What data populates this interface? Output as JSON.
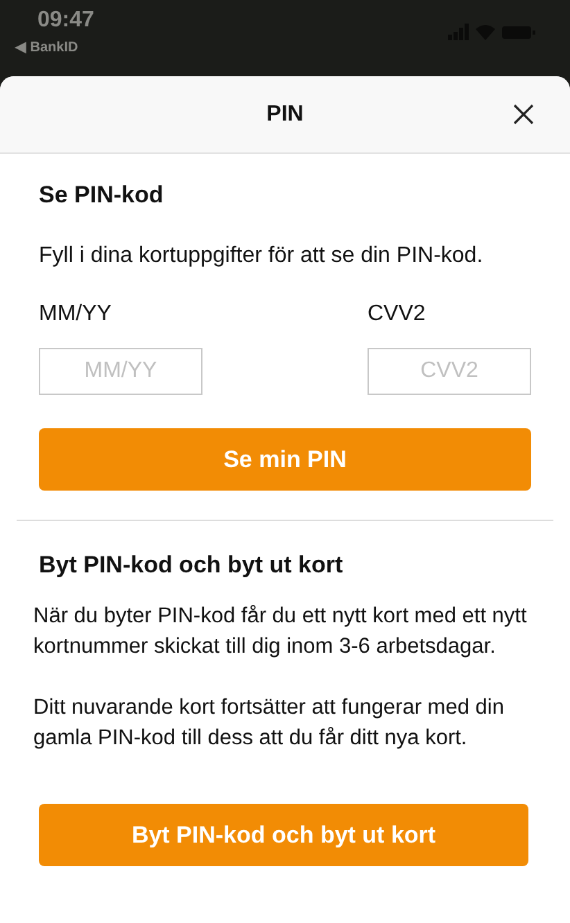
{
  "status_bar": {
    "time": "09:47",
    "back_label": "◀ BankID"
  },
  "sheet": {
    "title": "PIN"
  },
  "view_pin": {
    "heading": "Se PIN-kod",
    "text": "Fyll i dina kortuppgifter för att se din PIN-kod.",
    "fields": [
      {
        "label": "MM/YY",
        "placeholder": "MM/YY"
      },
      {
        "label": "CVV2",
        "placeholder": "CVV2"
      }
    ],
    "button": "Se min PIN"
  },
  "change_pin": {
    "heading": "Byt PIN-kod och byt ut kort",
    "paragraphs": [
      "När du byter PIN-kod får du ett nytt kort med ett nytt kortnummer skickat till dig inom 3-6 arbetsdagar.",
      "Ditt nuvarande kort fortsätter att fungerar med din gamla PIN-kod till dess att du får ditt nya kort."
    ],
    "button": "Byt PIN-kod och byt ut kort"
  }
}
